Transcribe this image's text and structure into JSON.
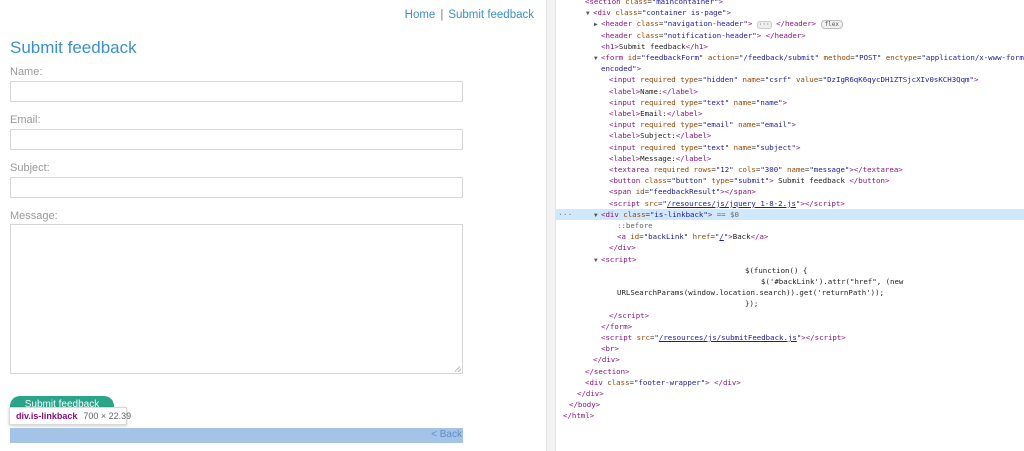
{
  "page": {
    "nav": {
      "home": "Home",
      "separator": "|",
      "feedback": "Submit feedback"
    },
    "title": "Submit feedback",
    "form": {
      "name_label": "Name:",
      "email_label": "Email:",
      "subject_label": "Subject:",
      "message_label": "Message:",
      "submit_label": "Submit feedback"
    },
    "back_link": "< Back",
    "tooltip": {
      "element": "div.is-linkback",
      "dimensions": "700 × 22.39"
    }
  },
  "devtools": {
    "lines": [
      {
        "indent": 2,
        "tri": "",
        "html": "<span class=\"tn\">&lt;section</span> <span class=\"an\">class</span>=<span class=\"av\">\"maincontainer\"</span><span class=\"tn\">&gt;</span>"
      },
      {
        "indent": 3,
        "tri": "▼",
        "html": "<span class=\"tn\">&lt;div</span> <span class=\"an\">class</span>=<span class=\"av\">\"container is-page\"</span><span class=\"tn\">&gt;</span>"
      },
      {
        "indent": 4,
        "tri": "▶",
        "html": "<span class=\"tn\">&lt;header</span> <span class=\"an\">class</span>=<span class=\"av\">\"navigation-header\"</span><span class=\"tn\">&gt;</span> <span class=\"ellipsis\">···</span> <span class=\"tn\">&lt;/header&gt;</span> <span class=\"flex-badge\">flex</span>"
      },
      {
        "indent": 4,
        "tri": "",
        "html": "<span class=\"tn\">&lt;header</span> <span class=\"an\">class</span>=<span class=\"av\">\"notification-header\"</span><span class=\"tn\">&gt;</span> <span class=\"tn\">&lt;/header&gt;</span>"
      },
      {
        "indent": 4,
        "tri": "",
        "html": "<span class=\"tn\">&lt;h1&gt;</span><span class=\"tx\">Submit feedback</span><span class=\"tn\">&lt;/h1&gt;</span>"
      },
      {
        "indent": 4,
        "tri": "▼",
        "html": "<span class=\"tn\">&lt;form</span> <span class=\"an\">id</span>=<span class=\"av\">\"feedbackForm\"</span> <span class=\"an\">action</span>=<span class=\"av\">\"/feedback/submit\"</span> <span class=\"an\">method</span>=<span class=\"av\">\"POST\"</span> <span class=\"an\">enctype</span>=<span class=\"av\">\"application/x-www-form-url</span>"
      },
      {
        "indent": 4,
        "tri": "",
        "html": "<span class=\"av\">encoded\"</span><span class=\"tn\">&gt;</span>"
      },
      {
        "indent": 5,
        "tri": "",
        "html": "<span class=\"tn\">&lt;input</span> <span class=\"an\">required type</span>=<span class=\"av\">\"hidden\"</span> <span class=\"an\">name</span>=<span class=\"av\">\"csrf\"</span> <span class=\"an\">value</span>=<span class=\"av\">\"DzIgR6qK6qycDH1ZTSjcXIv0sKCH3Qqm\"</span><span class=\"tn\">&gt;</span>"
      },
      {
        "indent": 5,
        "tri": "",
        "html": "<span class=\"tn\">&lt;label&gt;</span><span class=\"tx\">Name:</span><span class=\"tn\">&lt;/label&gt;</span>"
      },
      {
        "indent": 5,
        "tri": "",
        "html": "<span class=\"tn\">&lt;input</span> <span class=\"an\">required type</span>=<span class=\"av\">\"text\"</span> <span class=\"an\">name</span>=<span class=\"av\">\"name\"</span><span class=\"tn\">&gt;</span>"
      },
      {
        "indent": 5,
        "tri": "",
        "html": "<span class=\"tn\">&lt;label&gt;</span><span class=\"tx\">Email:</span><span class=\"tn\">&lt;/label&gt;</span>"
      },
      {
        "indent": 5,
        "tri": "",
        "html": "<span class=\"tn\">&lt;input</span> <span class=\"an\">required type</span>=<span class=\"av\">\"email\"</span> <span class=\"an\">name</span>=<span class=\"av\">\"email\"</span><span class=\"tn\">&gt;</span>"
      },
      {
        "indent": 5,
        "tri": "",
        "html": "<span class=\"tn\">&lt;label&gt;</span><span class=\"tx\">Subject:</span><span class=\"tn\">&lt;/label&gt;</span>"
      },
      {
        "indent": 5,
        "tri": "",
        "html": "<span class=\"tn\">&lt;input</span> <span class=\"an\">required type</span>=<span class=\"av\">\"text\"</span> <span class=\"an\">name</span>=<span class=\"av\">\"subject\"</span><span class=\"tn\">&gt;</span>"
      },
      {
        "indent": 5,
        "tri": "",
        "html": "<span class=\"tn\">&lt;label&gt;</span><span class=\"tx\">Message:</span><span class=\"tn\">&lt;/label&gt;</span>"
      },
      {
        "indent": 5,
        "tri": "",
        "html": "<span class=\"tn\">&lt;textarea</span> <span class=\"an\">required rows</span>=<span class=\"av\">\"12\"</span> <span class=\"an\">cols</span>=<span class=\"av\">\"300\"</span> <span class=\"an\">name</span>=<span class=\"av\">\"message\"</span><span class=\"tn\">&gt;&lt;/textarea&gt;</span>"
      },
      {
        "indent": 5,
        "tri": "",
        "html": "<span class=\"tn\">&lt;button</span> <span class=\"an\">class</span>=<span class=\"av\">\"button\"</span> <span class=\"an\">type</span>=<span class=\"av\">\"submit\"</span><span class=\"tn\">&gt;</span><span class=\"tx\"> Submit feedback </span><span class=\"tn\">&lt;/button&gt;</span>"
      },
      {
        "indent": 5,
        "tri": "",
        "html": "<span class=\"tn\">&lt;span</span> <span class=\"an\">id</span>=<span class=\"av\">\"feedbackResult\"</span><span class=\"tn\">&gt;&lt;/span&gt;</span>"
      },
      {
        "indent": 5,
        "tri": "",
        "html": "<span class=\"tn\">&lt;script</span> <span class=\"an\">src</span>=<span class=\"av\">\"</span><span class=\"av link\">/resources/js/jquery_1-8-2.js</span><span class=\"av\">\"</span><span class=\"tn\">&gt;&lt;/script&gt;</span>"
      },
      {
        "indent": 4,
        "tri": "▼",
        "selected": true,
        "html": "<span class=\"tn\">&lt;div</span> <span class=\"an\">class</span>=<span class=\"av\">\"is-linkback\"</span><span class=\"tn\">&gt;</span> <span class=\"cm\">== $0</span>"
      },
      {
        "indent": 6,
        "tri": "",
        "html": "<span class=\"cm\">::before</span>"
      },
      {
        "indent": 6,
        "tri": "",
        "html": "<span class=\"tn\">&lt;a</span> <span class=\"an\">id</span>=<span class=\"av\">\"backLink\"</span> <span class=\"an\">href</span>=<span class=\"av\">\"</span><span class=\"av link\">/</span><span class=\"av\">\"</span><span class=\"tn\">&gt;</span><span class=\"tx\">Back</span><span class=\"tn\">&lt;/a&gt;</span>"
      },
      {
        "indent": 5,
        "tri": "",
        "html": "<span class=\"tn\">&lt;/div&gt;</span>"
      },
      {
        "indent": 4,
        "tri": "▼",
        "html": "<span class=\"tn\">&lt;script&gt;</span>"
      },
      {
        "indent": 22,
        "tri": "",
        "html": "<span class=\"tx\">$(function() {</span>"
      },
      {
        "indent": 24,
        "tri": "",
        "html": "<span class=\"tx\">$('#backLink').attr(\"href\", (new</span>"
      },
      {
        "indent": 6,
        "tri": "",
        "html": "<span class=\"tx\">URLSearchParams(window.location.search)).get('returnPath'));</span>"
      },
      {
        "indent": 22,
        "tri": "",
        "html": "<span class=\"tx\">});</span>"
      },
      {
        "indent": 5,
        "tri": "",
        "html": "<span class=\"tn\">&lt;/script&gt;</span>"
      },
      {
        "indent": 4,
        "tri": "",
        "html": "<span class=\"tn\">&lt;/form&gt;</span>"
      },
      {
        "indent": 4,
        "tri": "",
        "html": "<span class=\"tn\">&lt;script</span> <span class=\"an\">src</span>=<span class=\"av\">\"</span><span class=\"av link\">/resources/js/submitFeedback.js</span><span class=\"av\">\"</span><span class=\"tn\">&gt;&lt;/script&gt;</span>"
      },
      {
        "indent": 4,
        "tri": "",
        "html": "<span class=\"tn\">&lt;br&gt;</span>"
      },
      {
        "indent": 3,
        "tri": "",
        "html": "<span class=\"tn\">&lt;/div&gt;</span>"
      },
      {
        "indent": 2,
        "tri": "",
        "html": "<span class=\"tn\">&lt;/section&gt;</span>"
      },
      {
        "indent": 2,
        "tri": "",
        "html": "<span class=\"tn\">&lt;div</span> <span class=\"an\">class</span>=<span class=\"av\">\"footer-wrapper\"</span><span class=\"tn\">&gt;</span> <span class=\"tn\">&lt;/div&gt;</span>"
      },
      {
        "indent": 1,
        "tri": "",
        "html": "<span class=\"tn\">&lt;/div&gt;</span>"
      },
      {
        "indent": 0,
        "tri": "",
        "html": "<span class=\"tn\">&lt;/body&gt;</span>"
      },
      {
        "indent": -1,
        "tri": "",
        "html": "<span class=\"tn\">&lt;/html&gt;</span>"
      }
    ]
  }
}
